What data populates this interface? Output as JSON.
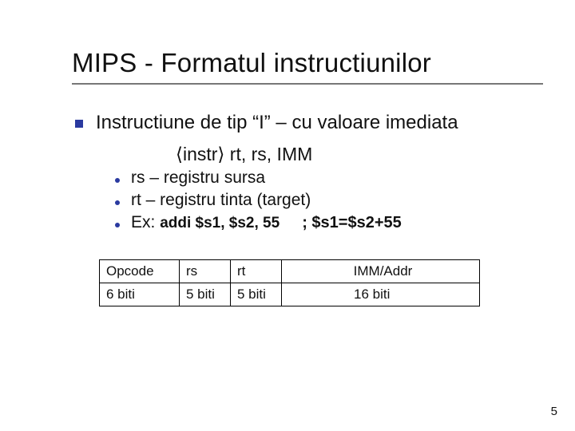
{
  "title": "MIPS - Formatul instructiunilor",
  "l1": "Instructiune de tip “I” – cu valoare imediata",
  "syntax": "⟨instr⟩ rt, rs, IMM",
  "l2": {
    "a": "rs – registru sursa",
    "b": "rt – registru tinta (target)",
    "ex_label": "Ex: ",
    "ex_code": "addi $s1, $s2, 55",
    "ex_comment": "; $s1=$s2+55"
  },
  "table": {
    "h_op": "Opcode",
    "h_rs": "rs",
    "h_rt": "rt",
    "h_imm": "IMM/Addr",
    "v_op": "6 biti",
    "v_rs": "5 biti",
    "v_rt": "5 biti",
    "v_imm": "16 biti"
  },
  "page": "5"
}
